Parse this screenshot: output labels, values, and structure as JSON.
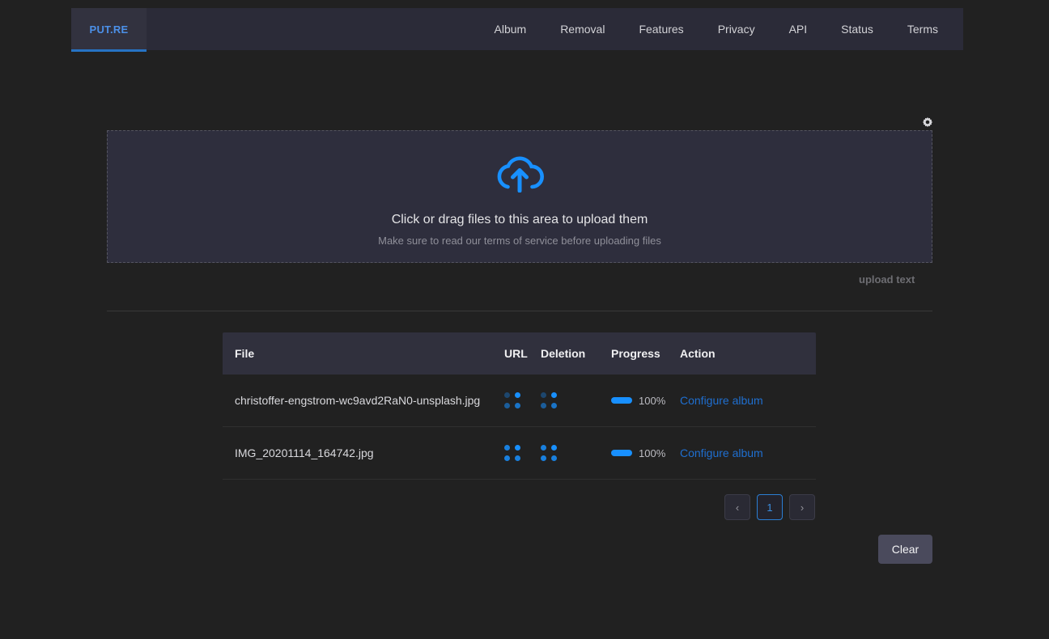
{
  "header": {
    "logo": "PUT.RE",
    "nav": [
      {
        "label": "Album"
      },
      {
        "label": "Removal"
      },
      {
        "label": "Features"
      },
      {
        "label": "Privacy"
      },
      {
        "label": "API"
      },
      {
        "label": "Status"
      },
      {
        "label": "Terms"
      }
    ]
  },
  "settings_icon": "gear-icon",
  "dropzone": {
    "icon": "cloud-upload-icon",
    "title": "Click or drag files to this area to upload them",
    "hint": "Make sure to read our terms of service before uploading files"
  },
  "upload_text_label": "upload text",
  "table": {
    "columns": {
      "file": "File",
      "url": "URL",
      "deletion": "Deletion",
      "progress": "Progress",
      "action": "Action"
    },
    "rows": [
      {
        "file": "christoffer-engstrom-wc9avd2RaN0-unsplash.jpg",
        "url_icon": "loading-spinner-icon",
        "deletion_icon": "loading-spinner-icon",
        "progress": "100%",
        "action": "Configure album"
      },
      {
        "file": "IMG_20201114_164742.jpg",
        "url_icon": "loading-spinner-icon",
        "deletion_icon": "loading-spinner-icon",
        "progress": "100%",
        "action": "Configure album"
      }
    ]
  },
  "pagination": {
    "prev": "‹",
    "pages": [
      {
        "label": "1",
        "active": true
      }
    ],
    "next": "›"
  },
  "clear_button": "Clear",
  "colors": {
    "page_bg": "#212121",
    "header_bg": "#2b2b38",
    "accent_blue": "#1890ff",
    "link_blue": "#1f6fd0",
    "dropzone_bg": "#2e2e3d",
    "clear_bg": "#4a4a5c"
  }
}
